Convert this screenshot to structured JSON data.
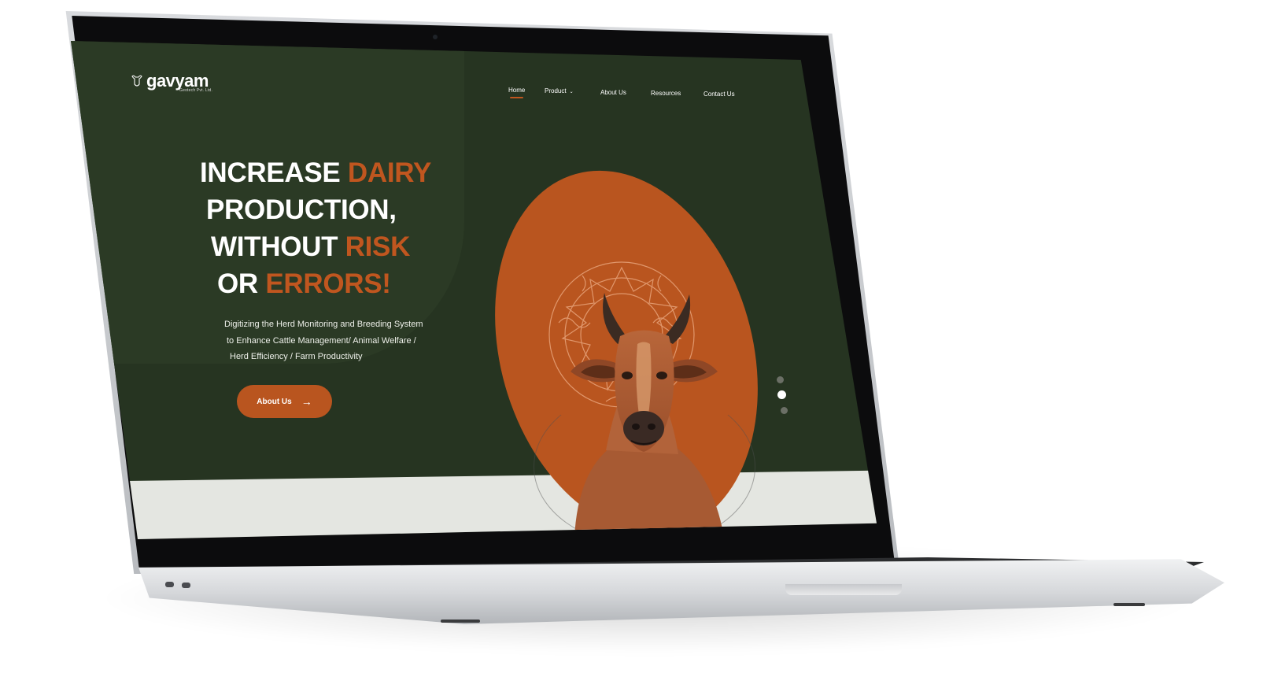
{
  "logo": {
    "name": "gavyam",
    "subtitle": "Geotech Pvt. Ltd."
  },
  "nav": {
    "items": [
      {
        "label": "Home",
        "active": true
      },
      {
        "label": "Product",
        "has_dropdown": true
      },
      {
        "label": "About Us"
      },
      {
        "label": "Resources"
      },
      {
        "label": "Contact Us"
      }
    ]
  },
  "hero": {
    "title_line1_white": "INCREASE ",
    "title_line1_accent": "DAIRY",
    "title_line2_white": "PRODUCTION,",
    "title_line3_white": "WITHOUT ",
    "title_line3_accent": "RISK",
    "title_line4_white": "OR ",
    "title_line4_accent": "ERRORS!",
    "description_lines": [
      "Digitizing the Herd Monitoring and Breeding System",
      "to Enhance Cattle Management/ Animal Welfare /",
      "Herd Efficiency / Farm Productivity"
    ],
    "cta_label": "About Us"
  },
  "slider": {
    "dots": 3,
    "active_index": 1
  },
  "colors": {
    "background": "#263421",
    "accent": "#c0561f",
    "band": "#e4e6e1"
  },
  "icons": {
    "cta_icon": "arrow-right-icon",
    "dropdown_icon": "chevron-down-icon",
    "logo_icon": "cow-head-icon"
  }
}
